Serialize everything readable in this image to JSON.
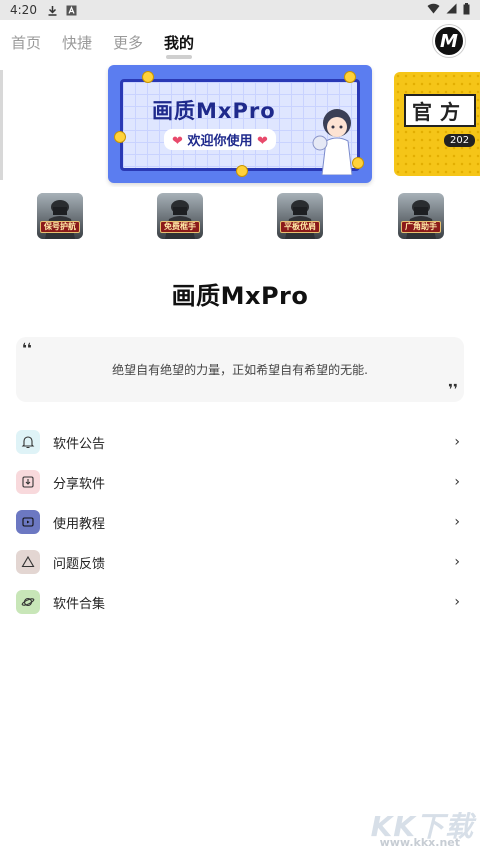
{
  "status_bar": {
    "time": "4:20",
    "icons": [
      "download-icon",
      "a-badge-icon"
    ],
    "right_icons": [
      "wifi-icon",
      "signal-icon",
      "battery-icon"
    ]
  },
  "tabs": [
    {
      "label": "首页",
      "active": false
    },
    {
      "label": "快捷",
      "active": false
    },
    {
      "label": "更多",
      "active": false
    },
    {
      "label": "我的",
      "active": true
    }
  ],
  "logo_badge": "M",
  "banners": {
    "main": {
      "title": "画质MxPro",
      "subtitle": "欢迎你使用",
      "colors": {
        "frame": "#5b7df0",
        "title": "#1f2a8c"
      }
    },
    "right_peek": {
      "text": "官方",
      "year": "202"
    }
  },
  "quick_items": [
    {
      "label": "保号护航",
      "icon": "pubg-soldier-icon"
    },
    {
      "label": "免费框手",
      "icon": "pubg-soldier-icon"
    },
    {
      "label": "平板优肩",
      "icon": "pubg-soldier-icon"
    },
    {
      "label": "广角助手",
      "icon": "pubg-soldier-icon"
    }
  ],
  "app_name": "画质MxPro",
  "quote": {
    "open_mark": "❛❛",
    "text": "绝望自有绝望的力量，正如希望自有希望的无能.",
    "close_mark": "❜❜"
  },
  "menu": [
    {
      "label": "软件公告",
      "icon": "bell-icon",
      "icon_bg": "#dff3f7"
    },
    {
      "label": "分享软件",
      "icon": "share-box-icon",
      "icon_bg": "#f8d9dc"
    },
    {
      "label": "使用教程",
      "icon": "video-play-icon",
      "icon_bg": "#6c78c2"
    },
    {
      "label": "问题反馈",
      "icon": "warning-triangle-icon",
      "icon_bg": "#e3d6d2"
    },
    {
      "label": "软件合集",
      "icon": "planet-icon",
      "icon_bg": "#c8e6b8"
    }
  ],
  "chevron_glyph": "›",
  "watermark": {
    "big": "KK下载",
    "small": "www.kkx.net"
  }
}
